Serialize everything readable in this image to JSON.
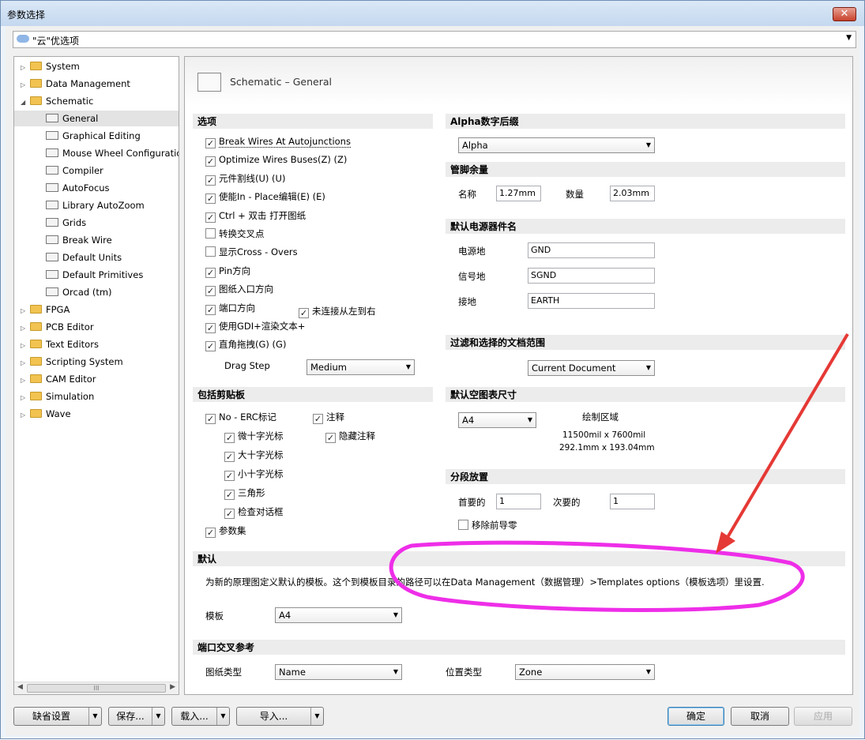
{
  "window": {
    "title": "参数选择",
    "close": "✕"
  },
  "cloudbar": {
    "label": "\"云\"优选项"
  },
  "tree": {
    "items": [
      {
        "label": "System",
        "type": "folder",
        "expanded": false
      },
      {
        "label": "Data Management",
        "type": "folder",
        "expanded": false
      },
      {
        "label": "Schematic",
        "type": "folder",
        "expanded": true
      },
      {
        "label": "General",
        "type": "page",
        "selected": true
      },
      {
        "label": "Graphical Editing",
        "type": "page"
      },
      {
        "label": "Mouse Wheel Configuration",
        "type": "page"
      },
      {
        "label": "Compiler",
        "type": "page"
      },
      {
        "label": "AutoFocus",
        "type": "page"
      },
      {
        "label": "Library AutoZoom",
        "type": "page"
      },
      {
        "label": "Grids",
        "type": "page"
      },
      {
        "label": "Break Wire",
        "type": "page"
      },
      {
        "label": "Default Units",
        "type": "page"
      },
      {
        "label": "Default Primitives",
        "type": "page"
      },
      {
        "label": "Orcad (tm)",
        "type": "page"
      },
      {
        "label": "FPGA",
        "type": "folder",
        "expanded": false
      },
      {
        "label": "PCB Editor",
        "type": "folder",
        "expanded": false
      },
      {
        "label": "Text Editors",
        "type": "folder",
        "expanded": false
      },
      {
        "label": "Scripting System",
        "type": "folder",
        "expanded": false
      },
      {
        "label": "CAM Editor",
        "type": "folder",
        "expanded": false
      },
      {
        "label": "Simulation",
        "type": "folder",
        "expanded": false
      },
      {
        "label": "Wave",
        "type": "folder",
        "expanded": false
      }
    ],
    "scroll_thumb": "III"
  },
  "panel": {
    "title": "Schematic – General",
    "options": {
      "header": "选项",
      "items": [
        {
          "label": "Break Wires At Autojunctions",
          "checked": true
        },
        {
          "label": "Optimize Wires Buses(Z) (Z)",
          "checked": true
        },
        {
          "label": "元件割线(U) (U)",
          "checked": true
        },
        {
          "label": "使能In - Place编辑(E) (E)",
          "checked": true
        },
        {
          "label": "Ctrl + 双击 打开图纸",
          "checked": true
        },
        {
          "label": "转换交叉点",
          "checked": false
        },
        {
          "label": "显示Cross - Overs",
          "checked": false
        },
        {
          "label": "Pin方向",
          "checked": true
        },
        {
          "label": "图纸入口方向",
          "checked": true
        },
        {
          "label": "端口方向",
          "checked": true
        },
        {
          "label": "使用GDI+渲染文本+",
          "checked": true
        },
        {
          "label": "直角拖拽(G) (G)",
          "checked": true
        }
      ],
      "unconnected": {
        "label": "未连接从左到右",
        "checked": true
      },
      "drag_step_label": "Drag Step",
      "drag_step_value": "Medium"
    },
    "clipboard": {
      "header": "包括剪贴板",
      "no_erc": "No - ERC标记",
      "note": "注释",
      "hidden_note": "隐藏注释",
      "sub": [
        "微十字光标",
        "大十字光标",
        "小十字光标",
        "三角形",
        "检查对话框"
      ],
      "params": "参数集"
    },
    "alpha": {
      "header": "Alpha数字后缀",
      "value": "Alpha"
    },
    "pin_margin": {
      "header": "管脚余量",
      "name_label": "名称",
      "name_value": "1.27mm",
      "num_label": "数量",
      "num_value": "2.03mm"
    },
    "power": {
      "header": "默认电源器件名",
      "rows": [
        {
          "label": "电源地",
          "value": "GND"
        },
        {
          "label": "信号地",
          "value": "SGND"
        },
        {
          "label": "接地",
          "value": "EARTH"
        }
      ]
    },
    "filter": {
      "header": "过滤和选择的文档范围",
      "value": "Current Document"
    },
    "sheet_size": {
      "header": "默认空图表尺寸",
      "value": "A4",
      "area_label": "绘制区域",
      "mil": "11500mil x 7600mil",
      "mm": "292.1mm x 193.04mm"
    },
    "segment": {
      "header": "分段放置",
      "primary_label": "首要的",
      "primary_value": "1",
      "secondary_label": "次要的",
      "secondary_value": "1",
      "remove_zero": "移除前导零"
    },
    "default": {
      "header": "默认",
      "desc": "为新的原理图定义默认的模板。这个到模板目录的路径可以在Data Management（数据管理）>Templates options（模板选项）里设置.",
      "template_label": "模板",
      "template_value": "A4"
    },
    "port_ref": {
      "header": "端口交叉参考",
      "sheet_type_label": "图纸类型",
      "sheet_type_value": "Name",
      "location_label": "位置类型",
      "location_value": "Zone"
    }
  },
  "buttons": {
    "defaults": "缺省设置",
    "save": "保存...",
    "load": "载入...",
    "import": "导入...",
    "ok": "确定",
    "cancel": "取消",
    "apply": "应用"
  },
  "annotation_colors": {
    "ellipse": "#ee2ee8",
    "arrow": "#e53935"
  }
}
